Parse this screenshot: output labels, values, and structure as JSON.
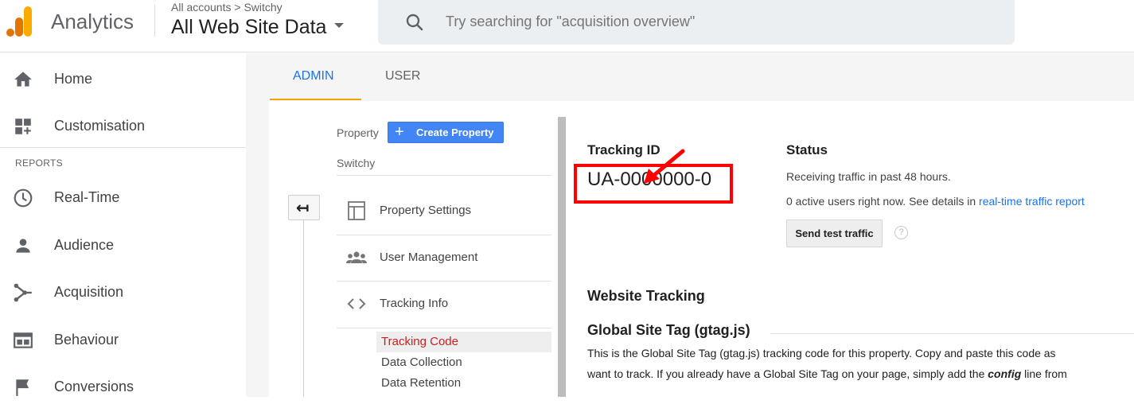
{
  "app": {
    "name": "Analytics"
  },
  "header": {
    "breadcrumb": "All accounts > Switchy",
    "view_name": "All Web Site Data",
    "search_placeholder": "Try searching for \"acquisition overview\""
  },
  "sidebar": {
    "items_top": [
      {
        "label": "Home",
        "icon": "home-icon"
      },
      {
        "label": "Customisation",
        "icon": "customisation-icon"
      }
    ],
    "section_label": "REPORTS",
    "items_reports": [
      {
        "label": "Real-Time",
        "icon": "clock-icon"
      },
      {
        "label": "Audience",
        "icon": "person-icon"
      },
      {
        "label": "Acquisition",
        "icon": "acquisition-icon"
      },
      {
        "label": "Behaviour",
        "icon": "behaviour-icon"
      },
      {
        "label": "Conversions",
        "icon": "flag-icon"
      }
    ]
  },
  "tabs": {
    "admin": "ADMIN",
    "user": "USER",
    "active": "ADMIN"
  },
  "property": {
    "label": "Property",
    "create_button": "Create Property",
    "name": "Switchy",
    "back_glyph": "↤",
    "menu": [
      {
        "label": "Property Settings",
        "icon": "property-settings-icon"
      },
      {
        "label": "User Management",
        "icon": "users-icon"
      },
      {
        "label": "Tracking Info",
        "icon": "code-icon"
      }
    ],
    "submenu": [
      {
        "label": "Tracking Code",
        "active": true
      },
      {
        "label": "Data Collection",
        "active": false
      },
      {
        "label": "Data Retention",
        "active": false
      }
    ]
  },
  "tracking": {
    "title": "Tracking ID",
    "id": "UA-0000000-0"
  },
  "status": {
    "title": "Status",
    "line1": "Receiving traffic in past 48 hours.",
    "line2_prefix": "0 active users right now. See details in ",
    "line2_link": "real-time traffic report",
    "test_button": "Send test traffic",
    "help_glyph": "?"
  },
  "website_tracking": {
    "title": "Website Tracking",
    "gst_title": "Global Site Tag (gtag.js)",
    "desc1": "This is the Global Site Tag (gtag.js) tracking code for this property. Copy and paste this code as",
    "desc2_prefix": "want to track. If you already have a Global Site Tag on your page, simply add the ",
    "desc2_bold": "config",
    "desc2_suffix": " line from"
  },
  "colors": {
    "accent_blue": "#1a73e8",
    "tab_underline": "#f4a300",
    "highlight_red": "#ff0000",
    "active_sub": "#c5221f",
    "logo_orange": "#f9ab00",
    "logo_dark_orange": "#e37400"
  }
}
